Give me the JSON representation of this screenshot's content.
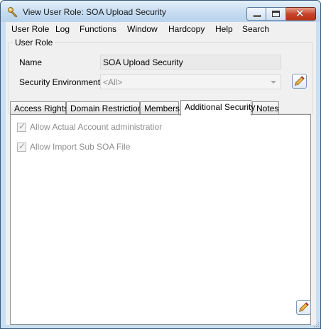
{
  "window": {
    "title": "View User Role: SOA Upload Security",
    "icon": "key-pencil-icon",
    "controls": [
      "minimize",
      "maximize",
      "close"
    ]
  },
  "menu": [
    "User Role",
    "Log",
    "Functions",
    "Window",
    "Hardcopy",
    "Help",
    "Search"
  ],
  "user_role": {
    "group_label": "User Role",
    "name_label": "Name",
    "name_value": "SOA Upload Security",
    "security_env_label": "Security Environment",
    "security_env_value": "<All>"
  },
  "tabs": [
    {
      "label": "Access Rights",
      "active": false
    },
    {
      "label": "Domain Restrictions",
      "active": false
    },
    {
      "label": "Members",
      "active": false
    },
    {
      "label": "Additional Security",
      "active": true
    },
    {
      "label": "Notes",
      "active": false
    }
  ],
  "additional_security": {
    "options": [
      {
        "label": "Allow Actual Account administratior",
        "checked": true,
        "enabled": false
      },
      {
        "label": "Allow Import Sub SOA File",
        "checked": true,
        "enabled": false
      }
    ]
  },
  "colors": {
    "title_bar": "#c4dbf0",
    "close_button": "#c8452c",
    "tab_active": "#ffffff",
    "disabled_text": "#8d8d8d"
  }
}
